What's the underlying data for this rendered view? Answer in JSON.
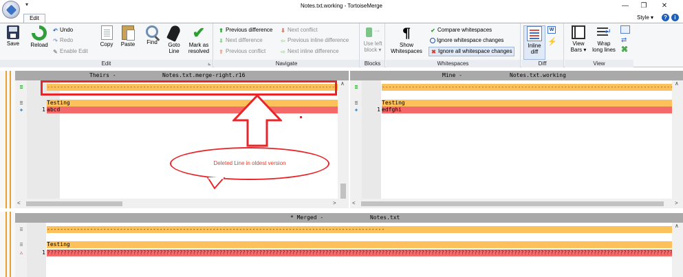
{
  "window": {
    "title": "Notes.txt.working - TortoiseMerge",
    "quick_access_arrow": "▾",
    "minimize": "—",
    "restore": "❐",
    "close": "✕"
  },
  "ribbon_tabs": {
    "edit": "Edit"
  },
  "style_menu": {
    "label": "Style ▾",
    "help_icon": "?",
    "info_icon": "i"
  },
  "groups": {
    "edit": {
      "label": "Edit",
      "save": "Save",
      "reload": "Reload",
      "undo": "Undo",
      "redo": "Redo",
      "enable_edit": "Enable Edit",
      "copy": "Copy",
      "paste": "Paste",
      "find": "Find",
      "goto_line_1": "Goto",
      "goto_line_2": "Line",
      "mark_resolved_1": "Mark as",
      "mark_resolved_2": "resolved"
    },
    "navigate": {
      "label": "Navigate",
      "previous_difference": "Previous difference",
      "next_difference": "Next difference",
      "previous_conflict": "Previous conflict",
      "next_conflict": "Next conflict",
      "previous_inline_difference": "Previous inline difference",
      "next_inline_difference": "Next inline difference"
    },
    "blocks": {
      "label": "Blocks",
      "use_left_block_1": "Use left",
      "use_left_block_2": "block ▾"
    },
    "whitespaces": {
      "label": "Whitespaces",
      "show_1": "Show",
      "show_2": "Whitespaces",
      "compare": "Compare whitespaces",
      "ignore_changes": "Ignore whitespace changes",
      "ignore_all": "Ignore all whitespace changes"
    },
    "diff": {
      "label": "Diff",
      "inline_1": "Inline",
      "inline_2": "diff"
    },
    "view": {
      "label": "View",
      "view_bars_1": "View",
      "view_bars_2": "Bars ▾",
      "wrap_1": "Wrap",
      "wrap_2": "long lines"
    }
  },
  "panes": {
    "theirs": {
      "header_left": "Theirs -",
      "header_file": "Notes.txt.merge-right.r16",
      "dashes": "--------------------------------------------------------------------------------------------------------------",
      "line2": "Testing",
      "line3_num": "1",
      "line3": "abcd"
    },
    "mine": {
      "header_left": "Mine -",
      "header_file": "Notes.txt.working",
      "dashes": "----------------------------------------------------------------------------------------------------------------",
      "line2": "Testing",
      "line3_num": "1",
      "line3": "edfghi"
    },
    "merged": {
      "header_left": "* Merged -",
      "header_file": "Notes.txt",
      "dashes": "------------------------------------------------------------------------------------------------------",
      "line2": "Testing",
      "line3_num": "1",
      "line3": "???????????????????????????????????????????????????????????????????????????????????????????????????????????????????????????????????????????????????????????????????????????????????????????????????????????????????????????????????????????????????????????????????????????"
    }
  },
  "annotation": {
    "callout": "Deleted Line in oldest version"
  },
  "colors": {
    "orange_row": "#fdc15c",
    "red_row": "#f46a6a",
    "annotation": "#e8262a"
  }
}
